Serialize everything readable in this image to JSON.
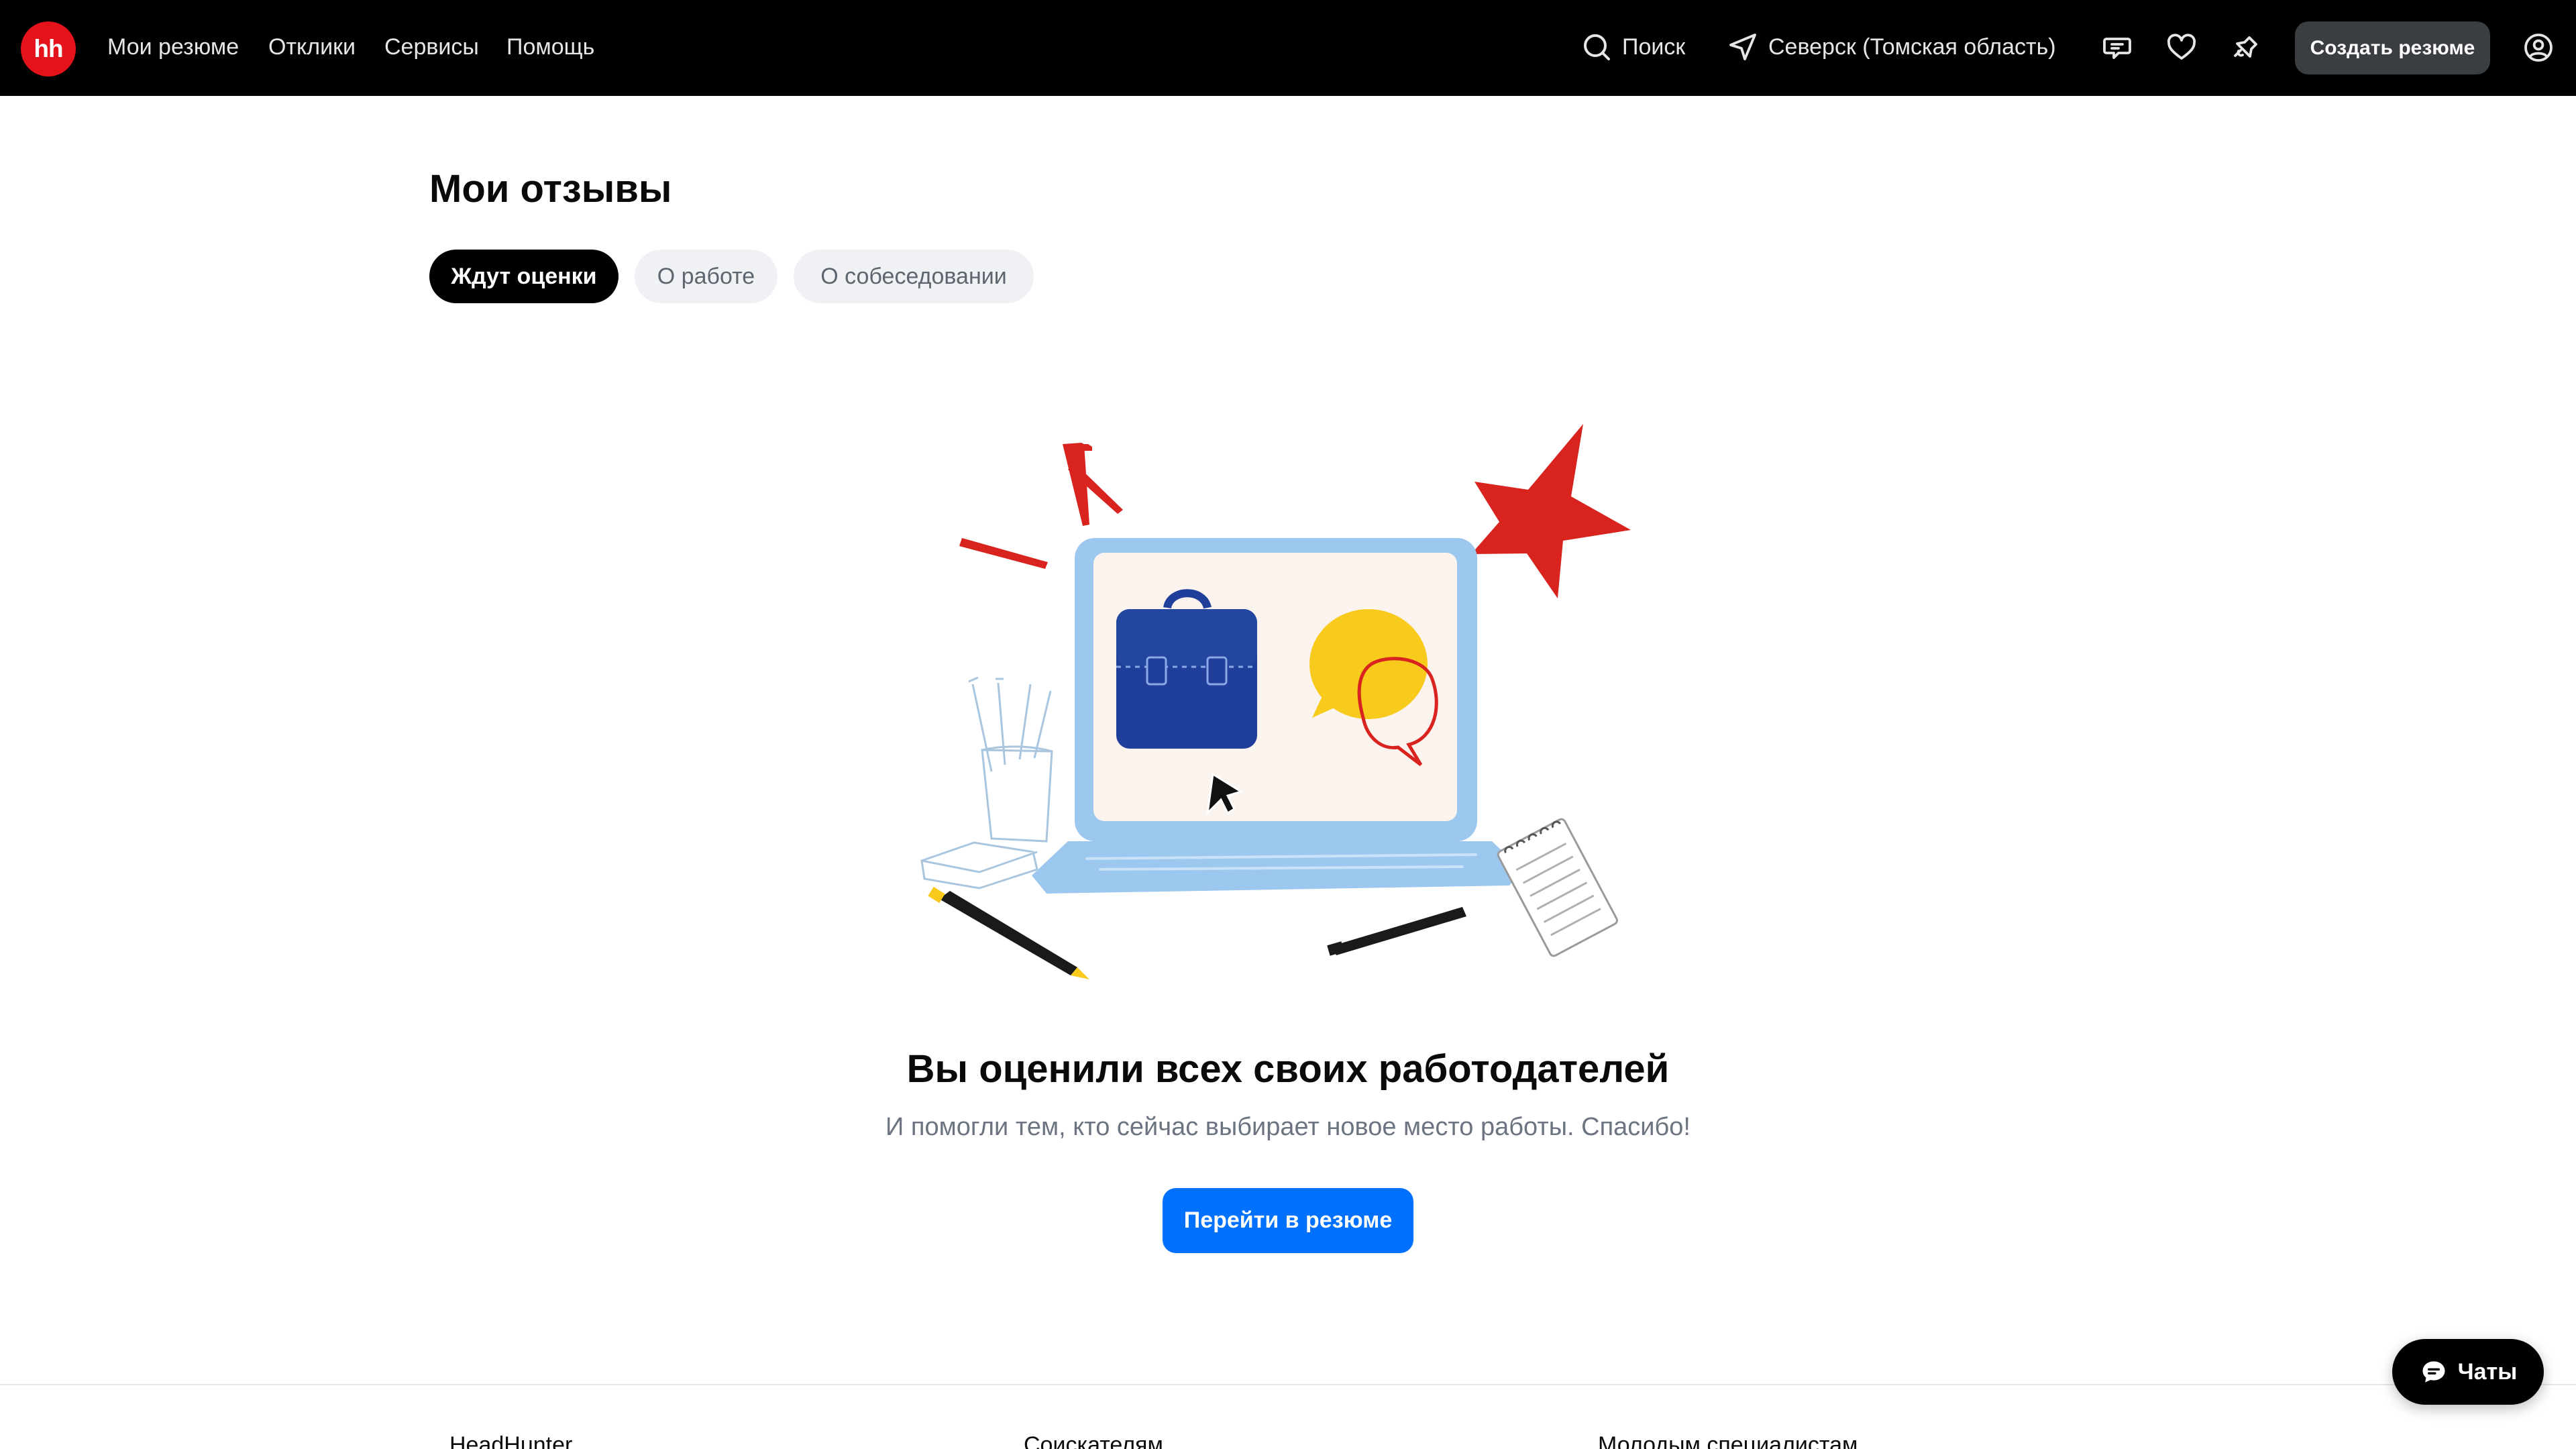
{
  "header": {
    "logo_text": "hh",
    "nav": [
      "Мои резюме",
      "Отклики",
      "Сервисы",
      "Помощь"
    ],
    "search_label": "Поиск",
    "location_label": "Северск (Томская область)",
    "create_resume_label": "Создать резюме",
    "icons": [
      "search-icon",
      "location-arrow-icon",
      "chat-bubble-icon",
      "heart-icon",
      "bell-icon",
      "user-icon"
    ]
  },
  "page": {
    "title": "Мои отзывы",
    "tabs": [
      "Ждут оценки",
      "О работе",
      "О собеседовании"
    ],
    "active_tab": "Ждут оценки"
  },
  "empty_state": {
    "title": "Вы оценили всех своих работодателей",
    "subtitle": "И помогли тем, кто сейчас выбирает новое место работы. Спасибо!",
    "button_label": "Перейти в резюме"
  },
  "footer": {
    "columns": [
      "HeadHunter",
      "Соискателям",
      "Молодым специалистам"
    ]
  },
  "chat_widget": {
    "label": "Чаты"
  },
  "colors": {
    "header_bg": "#000000",
    "brand_red": "#e3121b",
    "primary_blue": "#0070ff",
    "muted_text": "#6b7480"
  }
}
